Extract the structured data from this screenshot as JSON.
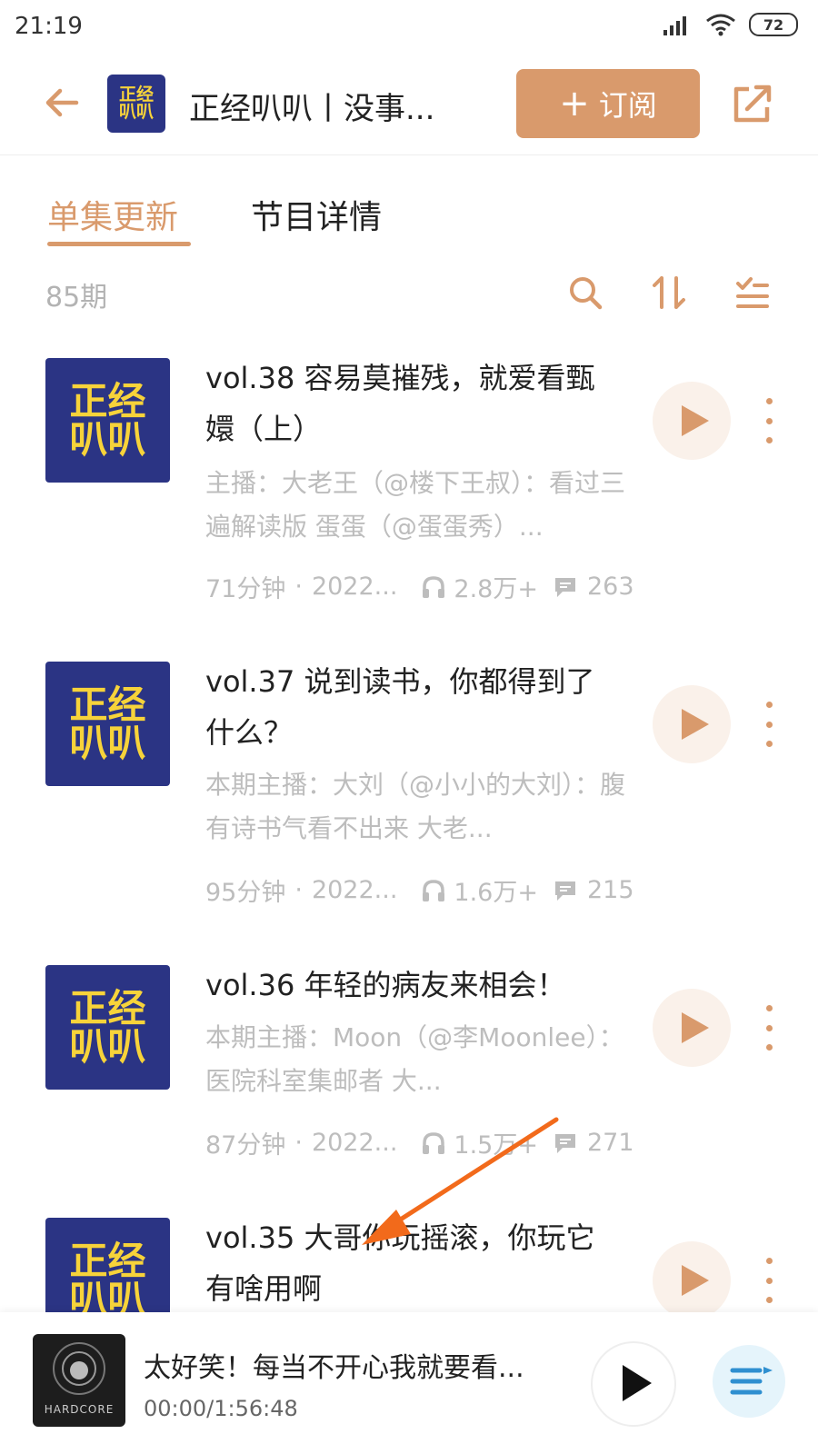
{
  "status_bar": {
    "time": "21:19",
    "battery": "72"
  },
  "header": {
    "title": "正经叭叭丨没事...",
    "subscribe_label": "订阅",
    "logo_line1": "正经",
    "logo_line2": "叭叭"
  },
  "tabs": [
    {
      "label": "单集更新",
      "active": true
    },
    {
      "label": "节目详情",
      "active": false
    }
  ],
  "episode_count": "85期",
  "episodes": [
    {
      "title": "vol.38 容易莫摧残，就爱看甄嬛（上）",
      "desc": "主播：大老王（@楼下王叔）：看过三遍解读版 蛋蛋（@蛋蛋秀）...",
      "duration": "71分钟",
      "date": "2022...",
      "plays": "2.8万+",
      "comments": "263"
    },
    {
      "title": "vol.37 说到读书，你都得到了什么？",
      "desc": "本期主播：大刘（@小小的大刘）：腹有诗书气看不出来 大老...",
      "duration": "95分钟",
      "date": "2022...",
      "plays": "1.6万+",
      "comments": "215"
    },
    {
      "title": "vol.36 年轻的病友来相会！",
      "desc": "本期主播：Moon（@李Moonlee）：医院科室集邮者 大...",
      "duration": "87分钟",
      "date": "2022...",
      "plays": "1.5万+",
      "comments": "271"
    },
    {
      "title": "vol.35 大哥你玩摇滚，你玩它有啥用啊"
    }
  ],
  "player": {
    "title": "太好笑！每当不开心我就要看...",
    "time": "00:00/1:56:48",
    "cover_text": "HARDCORE"
  },
  "colors": {
    "accent": "#d99a6c",
    "logo_bg": "#2b3484",
    "logo_fg": "#f7d33a",
    "annotation": "#f26a1b"
  }
}
